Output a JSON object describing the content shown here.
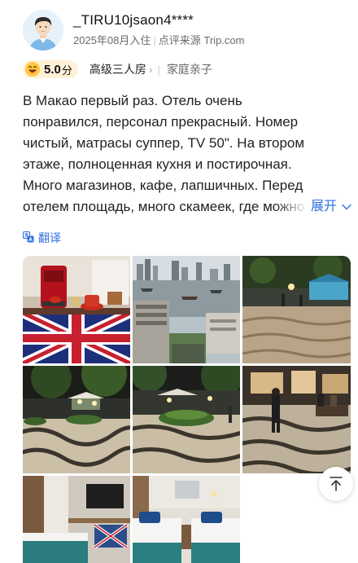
{
  "user": {
    "name": "_TIRU10jsaon4****",
    "stay_date": "2025年08月入住",
    "source": "点评来源 Trip.com",
    "avatar": "avatar-icon"
  },
  "rating": {
    "score": "5.0",
    "unit": "分",
    "room_type": "高级三人房",
    "trip_type": "家庭亲子",
    "emoji": "grinning-face-icon"
  },
  "review": {
    "text": "В Макао первый раз. Отель очень понравился, персонал прекрасный. Номер чистый, матрасы суппер, TV 50\". На втором этаже, полноценная кухня и постирочная. Много магазинов, кафе, лапшичных. Перед отелем площадь, много скамеек, где можно по",
    "expand_label": "展开"
  },
  "translate": {
    "label": "翻译"
  },
  "photos": [
    {
      "subject": "coffee machine on union jack fridge"
    },
    {
      "subject": "river view with city skyline"
    },
    {
      "subject": "night plaza with wave pavement"
    },
    {
      "subject": "night plaza with trees"
    },
    {
      "subject": "night plaza with flower beds"
    },
    {
      "subject": "people walking on plaza"
    },
    {
      "subject": "hotel room with tv"
    },
    {
      "subject": "hotel room twin beds"
    }
  ],
  "colors": {
    "accent": "#2f6fe0",
    "rating_chip": "#fff1d6",
    "meta_text": "#6a6a6a"
  }
}
